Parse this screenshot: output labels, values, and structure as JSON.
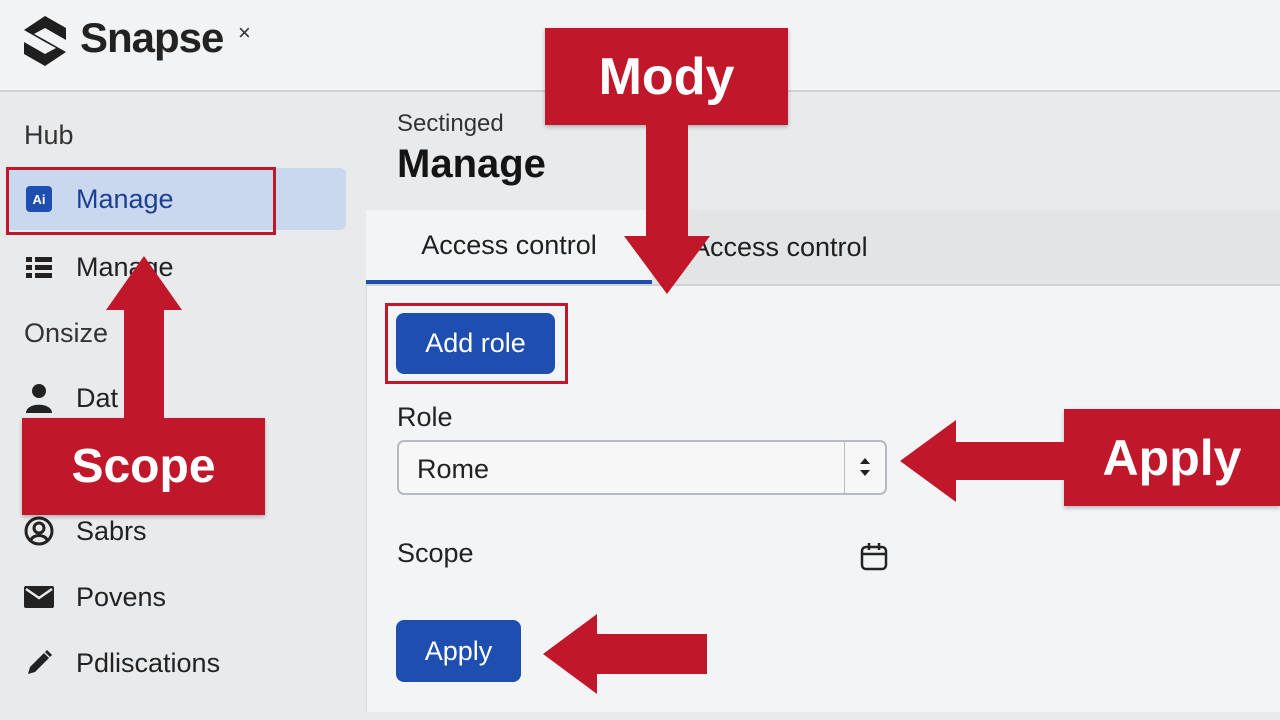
{
  "app": {
    "title": "Snapse",
    "close_glyph": "×",
    "logo_icon": "snapse-logo-icon"
  },
  "sidebar": {
    "section_hub": "Hub",
    "section_second": "Onsize",
    "items": [
      {
        "label": "Manage",
        "icon": "manage-icon",
        "active": true
      },
      {
        "label": "Manage",
        "icon": "grid-icon"
      },
      {
        "label": "Dat",
        "icon": "user-icon"
      },
      {
        "label": "Sabrs",
        "icon": "user-circle-icon"
      },
      {
        "label": "Povens",
        "icon": "mail-icon"
      },
      {
        "label": "Pdliscations",
        "icon": "pen-icon"
      }
    ]
  },
  "main": {
    "breadcrumb": "Sectinged",
    "title": "Manage",
    "tabs": [
      {
        "label": "Access control",
        "active": true
      },
      {
        "label": "Access control",
        "active": false
      }
    ],
    "add_role_label": "Add role",
    "role_label": "Role",
    "role_value": "Rome",
    "scope_label": "Scope",
    "apply_label": "Apply"
  },
  "annotations": {
    "mody": "Mody",
    "scope": "Scope",
    "apply": "Apply",
    "color": "#c0182a"
  },
  "colors": {
    "primary": "#1e4fb0",
    "active_nav_bg": "#c9d8ee"
  }
}
